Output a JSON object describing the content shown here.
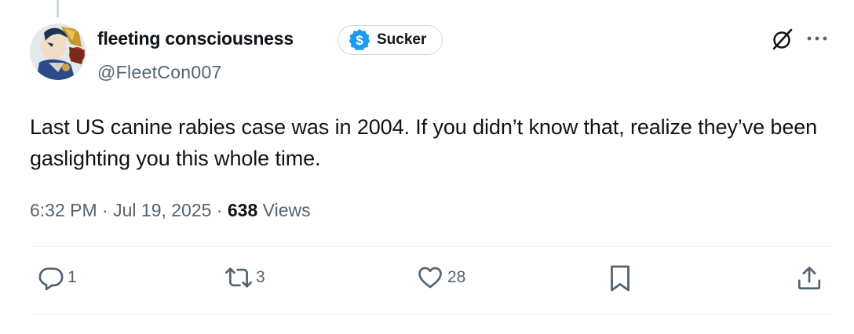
{
  "author": {
    "display_name": "fleeting consciousness",
    "handle": "@FleetCon007",
    "badge_label": "Sucker",
    "badge_icon": "dollar-coin-icon",
    "badge_color": "#1d9bf0"
  },
  "tweet": {
    "text": "Last US canine rabies case was in 2004.  If you didn’t know that, realize they’ve been gaslighting you this whole time.",
    "time": "6:32 PM",
    "separator": "·",
    "date": "Jul 19, 2025",
    "views_count": "638",
    "views_label": "Views"
  },
  "actions": {
    "reply_count": "1",
    "retweet_count": "3",
    "like_count": "28"
  },
  "colors": {
    "text_primary": "#0f1419",
    "text_secondary": "#536471",
    "divider": "#eff3f4",
    "accent": "#1d9bf0"
  },
  "icons": [
    "grok-icon",
    "more-icon",
    "reply-icon",
    "retweet-icon",
    "like-icon",
    "bookmark-icon",
    "share-icon"
  ]
}
